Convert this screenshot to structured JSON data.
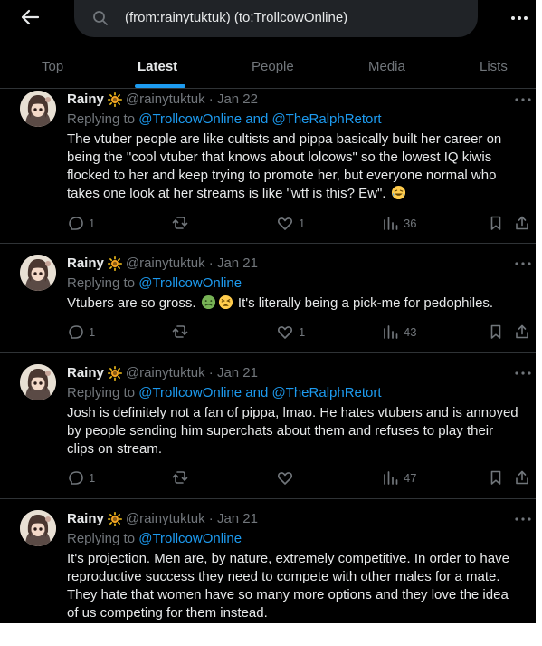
{
  "search": {
    "query": "(from:rainytuktuk) (to:TrollcowOnline)"
  },
  "tabs": [
    {
      "label": "Top"
    },
    {
      "label": "Latest"
    },
    {
      "label": "People"
    },
    {
      "label": "Media"
    },
    {
      "label": "Lists"
    }
  ],
  "colors": {
    "background": "#000000",
    "accent": "#1d9bf0",
    "text": "#e7e9ea",
    "muted": "#71767b",
    "border": "#2f3336"
  },
  "tweets": [
    {
      "name": "Rainy",
      "handle": "@rainytuktuk",
      "date": "· Jan 22",
      "replying_prefix": "Replying to ",
      "replying_to": "@TrollcowOnline and @TheRalphRetort",
      "text": "The vtuber people are like cultists and pippa basically built her career on being the \"cool vtuber that knows about lolcows\" so the lowest IQ kiwis flocked to her and keep trying to promote her, but everyone normal who takes one look at her streams is like \"wtf is this? Ew\".",
      "replies": "1",
      "retweets": "",
      "likes": "1",
      "views": "36"
    },
    {
      "name": "Rainy",
      "handle": "@rainytuktuk",
      "date": "· Jan 21",
      "replying_prefix": "Replying to ",
      "replying_to": "@TrollcowOnline",
      "text_a": "Vtubers are so gross.",
      "text_b": "It's literally being a pick-me for pedophiles.",
      "replies": "1",
      "retweets": "",
      "likes": "1",
      "views": "43"
    },
    {
      "name": "Rainy",
      "handle": "@rainytuktuk",
      "date": "· Jan 21",
      "replying_prefix": "Replying to ",
      "replying_to": "@TrollcowOnline and @TheRalphRetort",
      "text": "Josh is definitely not a fan of pippa, lmao. He hates vtubers and is annoyed by people sending him superchats about them and refuses to play their clips on stream.",
      "replies": "1",
      "retweets": "",
      "likes": "",
      "views": "47"
    },
    {
      "name": "Rainy",
      "handle": "@rainytuktuk",
      "date": "· Jan 21",
      "replying_prefix": "Replying to ",
      "replying_to": "@TrollcowOnline",
      "text": "It's projection. Men are, by nature, extremely competitive. In order to have reproductive success they need to compete with other males for a mate. They hate that women have so many more options and they love the idea of us competing for them instead."
    }
  ]
}
